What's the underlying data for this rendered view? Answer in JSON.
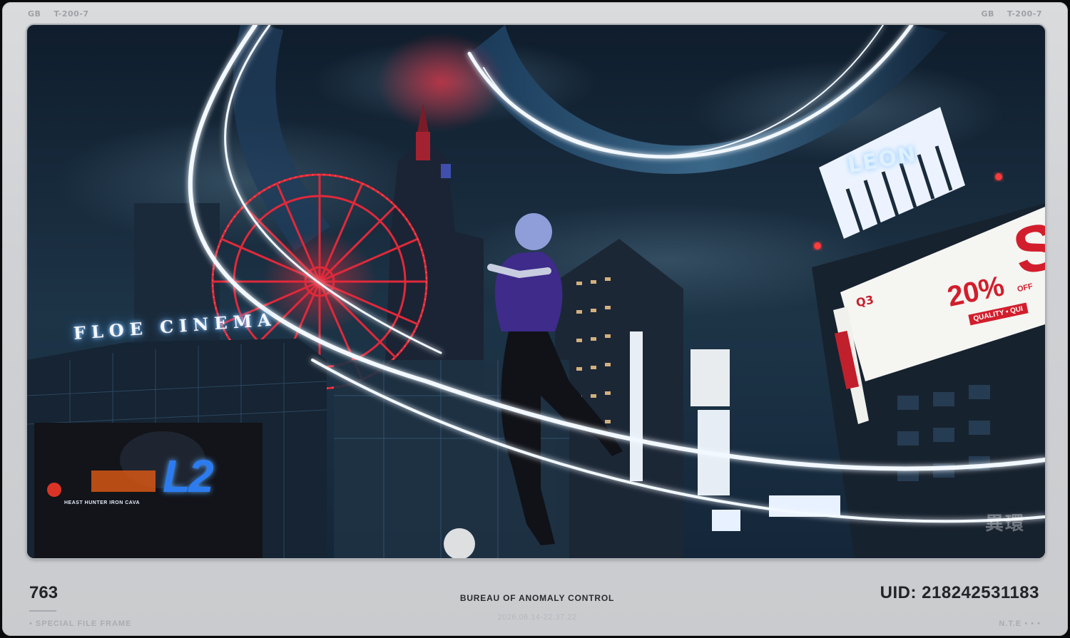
{
  "header": {
    "left_code": "GB",
    "left_id": "T-200-7",
    "right_code": "GB",
    "right_id": "T-200-7"
  },
  "scene": {
    "cinema_sign": "FLOE CINEMA",
    "leon_sign": "LEON",
    "billboard_logo": "Q3",
    "billboard_percent": "20%",
    "billboard_off": "OFF",
    "billboard_quality": "QUALITY • QUI",
    "billboard_big_letter": "S",
    "poster_logo": "L2",
    "poster_subtitle": "HEAST HUNTER IRON CAVA",
    "watermark": "異環"
  },
  "footer": {
    "number": "763",
    "left_sub": "• SPECIAL FILE FRAME",
    "center_title": "BUREAU OF ANOMALY CONTROL",
    "date": "2026.06.14-22.37.22",
    "uid": "UID: 218242531183",
    "right_sub": "N.T.E • • •"
  },
  "colors": {
    "frame": "#d2d4d7",
    "sky": "#14263a",
    "neon_red": "#e0293a",
    "neon_white": "#f2f8ff",
    "billboard_red": "#d21e2c"
  }
}
